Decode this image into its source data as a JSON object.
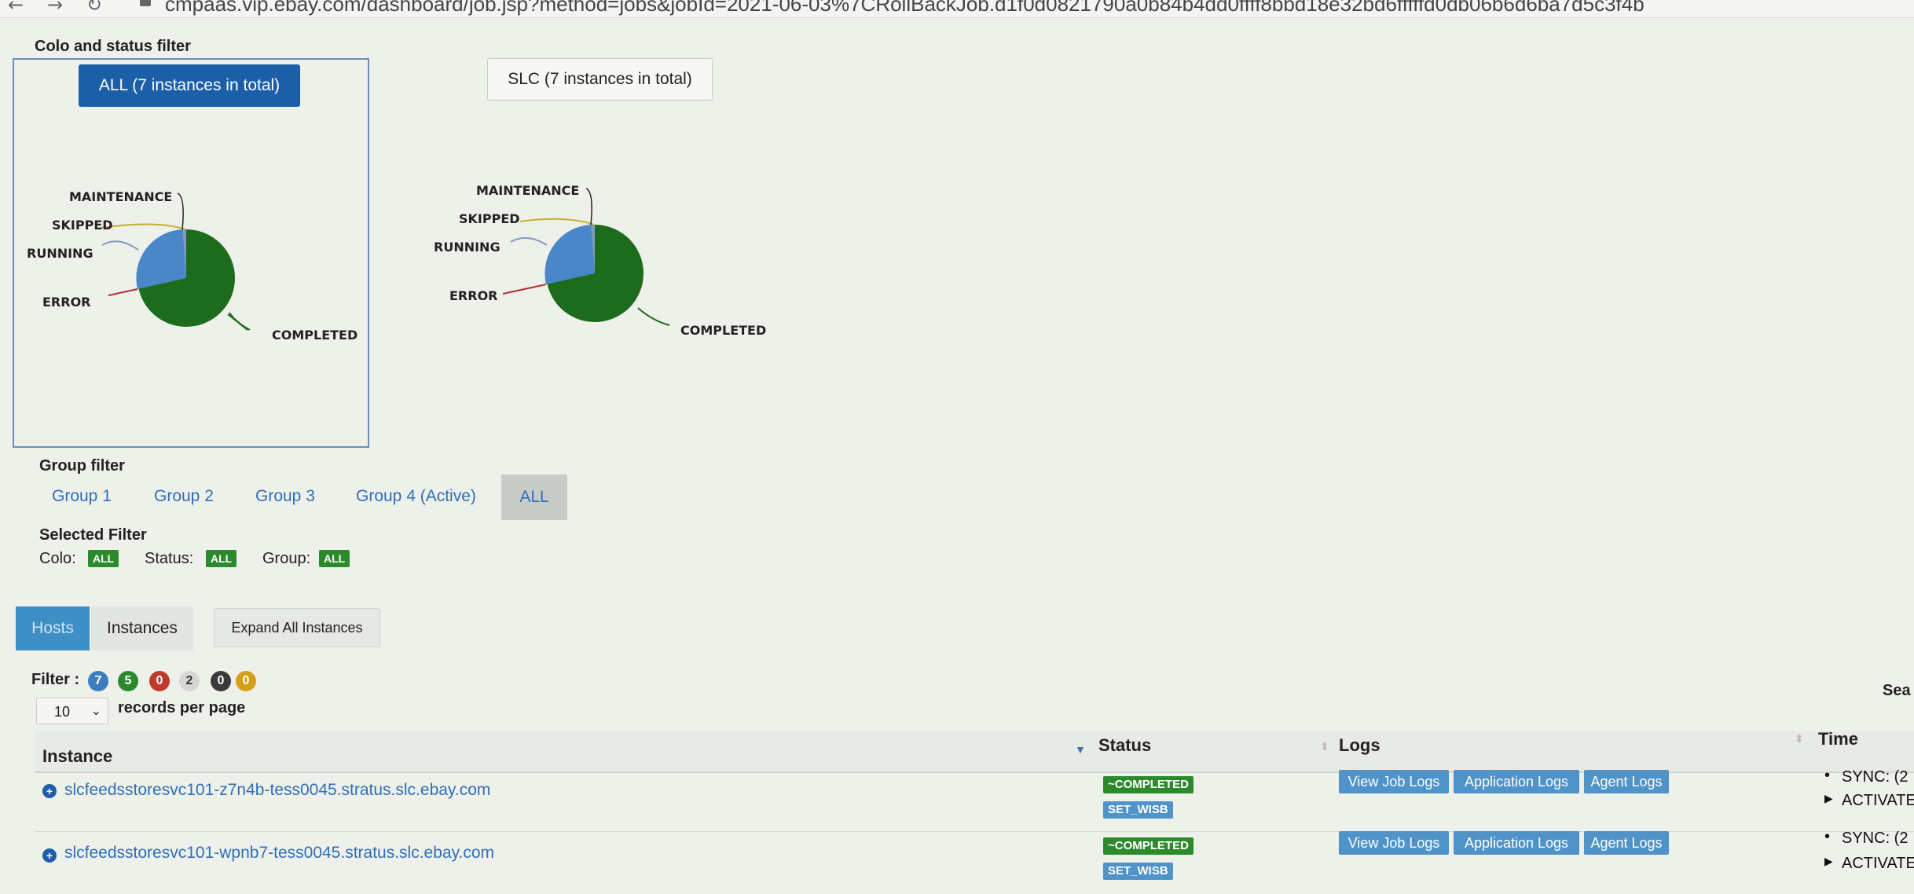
{
  "browser": {
    "url": "cmpaas.vip.ebay.com/dashboard/job.jsp?method=jobs&jobId=2021-06-03%7CRollBackJob.d1f0d0821790a0b84b4dd0ffff8bbd18e32bd6fffffd0db06b6d6ba7d5c3f4b",
    "back_icon": "arrow-left-icon",
    "forward_icon": "arrow-right-icon",
    "reload_icon": "reload-icon"
  },
  "colo_filter": {
    "title": "Colo and status filter",
    "all_label": "ALL (7 instances in total)",
    "slc_label": "SLC (7 instances in total)"
  },
  "pie_labels": {
    "maintenance": "MAINTENANCE",
    "skipped": "SKIPPED",
    "running": "RUNNING",
    "error": "ERROR",
    "completed": "COMPLETED"
  },
  "pie_colors": {
    "completed": "#1d6b1d",
    "running": "#4a87c8",
    "maintenance": "#c4b02a",
    "skipped": "#7f9bbf",
    "error": "#b23232"
  },
  "group_filter": {
    "title": "Group filter",
    "items": [
      "Group 1",
      "Group 2",
      "Group 3",
      "Group 4 (Active)"
    ],
    "all_label": "ALL"
  },
  "selected_filter": {
    "title": "Selected Filter",
    "colo_label": "Colo:",
    "colo_value": "ALL",
    "status_label": "Status:",
    "status_value": "ALL",
    "group_label": "Group:",
    "group_value": "ALL"
  },
  "tabs": {
    "hosts": "Hosts",
    "instances": "Instances",
    "expand": "Expand All Instances"
  },
  "filter_bar": {
    "label": "Filter :",
    "counts": [
      "7",
      "5",
      "0",
      "2",
      "0",
      "0"
    ],
    "colors": [
      "#3b7dc0",
      "#2c8a2c",
      "#c0392b",
      "#d6d7d2",
      "#3a3a3a",
      "#d4a017"
    ],
    "text_colors": [
      "#ffffff",
      "#ffffff",
      "#ffffff",
      "#333333",
      "#ffffff",
      "#ffffff"
    ]
  },
  "pagination": {
    "per_page_value": "10",
    "per_page_label": "records per page",
    "search_label": "Sea"
  },
  "table": {
    "headers": {
      "instance": "Instance",
      "status": "Status",
      "logs": "Logs",
      "time": "Time"
    },
    "rows": [
      {
        "instance": "slcfeedsstoresvc101-z7n4b-tess0045.stratus.slc.ebay.com",
        "status": "~COMPLETED",
        "sub_status": "SET_WISB",
        "logs": [
          "View Job Logs",
          "Application Logs",
          "Agent Logs"
        ],
        "time1": "SYNC: (2",
        "time2": "ACTIVATE"
      },
      {
        "instance": "slcfeedsstoresvc101-wpnb7-tess0045.stratus.slc.ebay.com",
        "status": "~COMPLETED",
        "sub_status": "SET_WISB",
        "logs": [
          "View Job Logs",
          "Application Logs",
          "Agent Logs"
        ],
        "time1": "SYNC: (2",
        "time2": "ACTIVATE"
      }
    ]
  }
}
